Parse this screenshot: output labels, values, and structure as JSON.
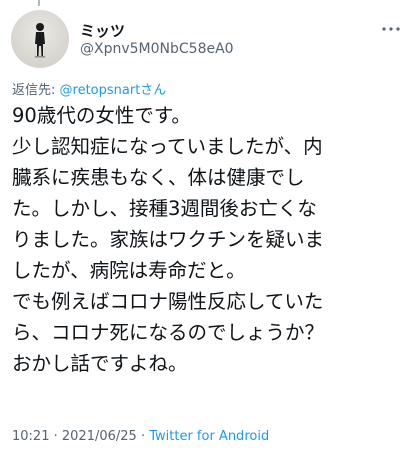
{
  "author": {
    "display_name": "ミッツ",
    "handle": "@Xpnv5M0NbC58eA0"
  },
  "reply_to": {
    "prefix": "返信先: ",
    "mention": "@retopsnart",
    "suffix": "さん"
  },
  "tweet_lines": [
    "90歳代の女性です。",
    "少し認知症になっていましたが、内",
    "臓系に疾患もなく、体は健康でし",
    "た。しかし、接種3週間後お亡くな",
    "りました。家族はワクチンを疑いま",
    "したが、病院は寿命だと。",
    "でも例えばコロナ陽性反応していた",
    "ら、コロナ死になるのでしょうか？",
    "おかし話ですよね。"
  ],
  "meta": {
    "time": "10:21",
    "separator1": " · ",
    "date": "2021/06/25",
    "separator2": " · ",
    "source": "Twitter for Android"
  },
  "icons": {
    "more": "more-horizontal-icon",
    "avatar": "avatar-silhouette"
  },
  "colors": {
    "text": "#0f1419",
    "secondary": "#536471",
    "link": "#1d9bf0"
  }
}
